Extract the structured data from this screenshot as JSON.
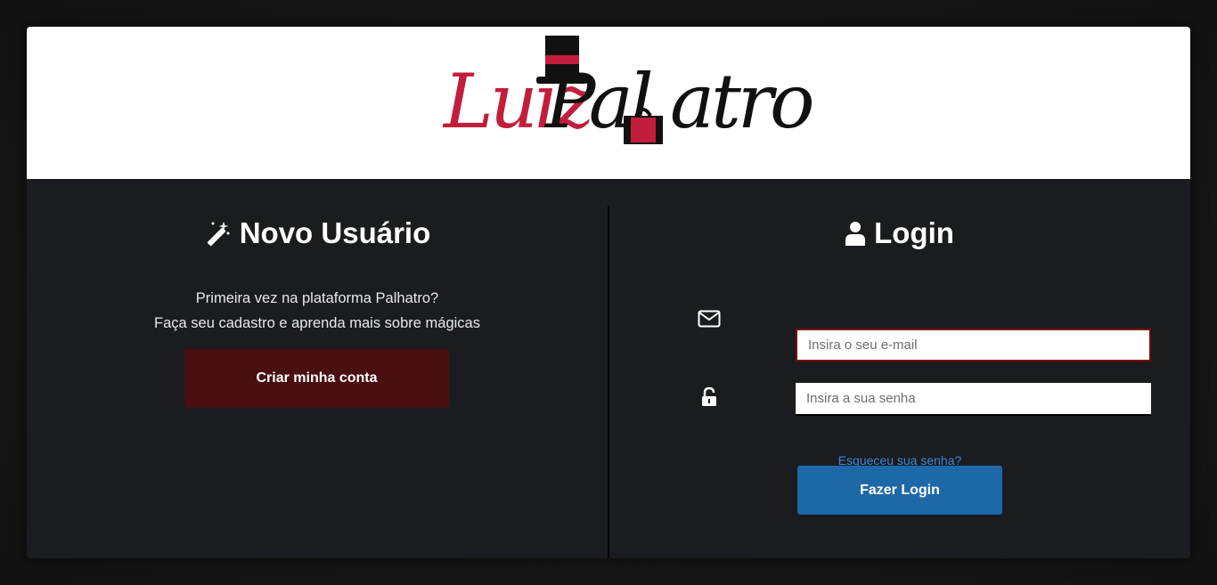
{
  "brand": {
    "logo_name": "Luiz Palhatro logo",
    "part_luiz": "Luiz",
    "part_pal": "Pal",
    "part_atro": "atro",
    "accent_red": "#c21e3c"
  },
  "new_user": {
    "icon": "magic-wand-icon",
    "title": "Novo Usuário",
    "intro_line1": "Primeira vez na plataforma Palhatro?",
    "intro_line2": "Faça seu cadastro e aprenda mais sobre mágicas",
    "create_button": "Criar minha conta",
    "button_color": "#4a0f10"
  },
  "login": {
    "icon": "user-icon",
    "title": "Login",
    "email": {
      "icon": "envelope-icon",
      "placeholder": "Insira o seu e-mail",
      "value": ""
    },
    "password": {
      "icon": "unlock-icon",
      "placeholder": "Insira a sua senha",
      "value": ""
    },
    "forgot_link": "Esqueceu sua senha?",
    "submit_button": "Fazer Login",
    "button_color": "#1f68a8"
  }
}
